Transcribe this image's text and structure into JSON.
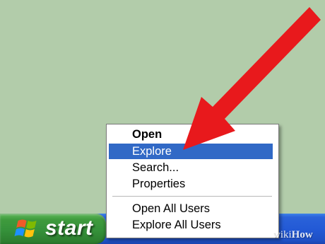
{
  "taskbar": {
    "start_label": "start"
  },
  "context_menu": {
    "items": [
      {
        "label": "Open",
        "bold": true,
        "selected": false
      },
      {
        "label": "Explore",
        "bold": false,
        "selected": true
      },
      {
        "label": "Search...",
        "bold": false,
        "selected": false
      },
      {
        "label": "Properties",
        "bold": false,
        "selected": false
      },
      {
        "label": "Open All Users",
        "bold": false,
        "selected": false
      },
      {
        "label": "Explore All Users",
        "bold": false,
        "selected": false
      }
    ]
  },
  "watermark": {
    "wiki": "wiki",
    "how": "How"
  },
  "colors": {
    "desktop": "#b2ccaa",
    "taskbar_blue": "#235ad6",
    "start_green": "#35913a",
    "menu_highlight": "#3169c6",
    "arrow_red": "#e8191c"
  },
  "icons": [
    "windows-logo-icon",
    "red-arrow-annotation"
  ]
}
